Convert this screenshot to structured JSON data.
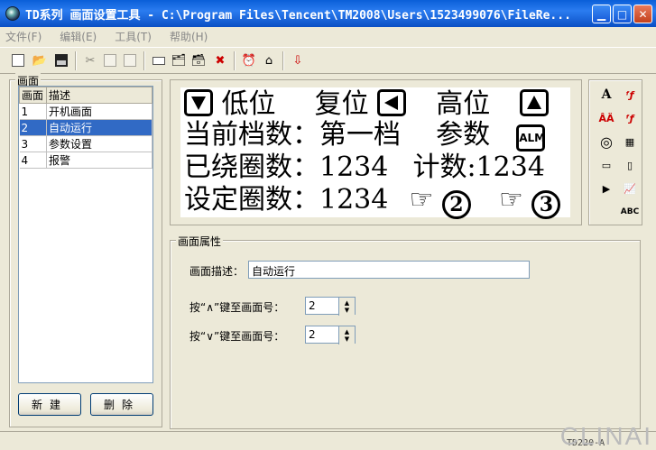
{
  "window": {
    "title": "TD系列 画面设置工具 - C:\\Program Files\\Tencent\\TM2008\\Users\\1523499076\\FileRe..."
  },
  "menu": {
    "items": [
      "文件(F)",
      "编辑(E)",
      "工具(T)",
      "帮助(H)"
    ]
  },
  "screens_panel": {
    "label": "画面",
    "columns": [
      "画面",
      "描述"
    ],
    "rows": [
      [
        "1",
        "开机画面"
      ],
      [
        "2",
        "自动运行"
      ],
      [
        "3",
        "参数设置"
      ],
      [
        "4",
        "报警"
      ]
    ],
    "selected_row": 2,
    "new_button": "新建",
    "delete_button": "删除"
  },
  "lcd": {
    "row1": {
      "text_a": "低位",
      "text_b": "复位",
      "text_c": "高位"
    },
    "row2": {
      "text": "当前档数：第一档",
      "text_b": "参数",
      "alm": "ALM"
    },
    "row3": {
      "text": "已绕圈数：1234",
      "text_b": "计数:1234"
    },
    "row4": {
      "text": "设定圈数：1234",
      "circle_2": "2",
      "circle_3": "3"
    }
  },
  "palette": {
    "text_btn": "A",
    "abc_btn": "ABC"
  },
  "properties": {
    "label": "画面属性",
    "desc_label": "画面描述：",
    "desc_value": "自动运行",
    "up_key_label": "按“∧”键至画面号：",
    "up_key_value": "2",
    "down_key_label": "按“∨”键至画面号：",
    "down_key_value": "2"
  },
  "status": {
    "model": "TD220-A",
    "watermark": "CLINAI"
  }
}
